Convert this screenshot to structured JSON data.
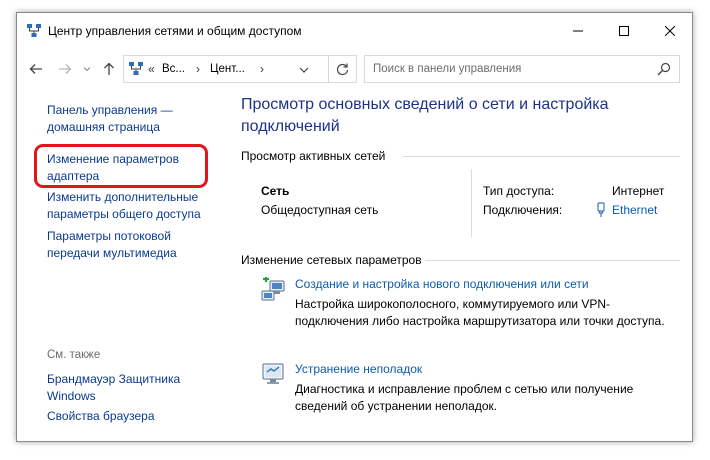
{
  "window": {
    "title": "Центр управления сетями и общим доступом"
  },
  "nav": {
    "address_crumbs": [
      "Вс...",
      "Цент..."
    ],
    "address_prefix": "«",
    "search_placeholder": "Поиск в панели управления"
  },
  "sidebar": {
    "home_link": "Панель управления — домашняя страница",
    "items": [
      {
        "label": "Изменение параметров адаптера",
        "highlighted": true
      },
      {
        "label": "Изменить дополнительные параметры общего доступа"
      },
      {
        "label": "Параметры потоковой передачи мультимедиа"
      }
    ],
    "see_also_label": "См. также",
    "see_also": [
      {
        "label": "Брандмауэр Защитника Windows"
      },
      {
        "label": "Свойства браузера"
      }
    ]
  },
  "main": {
    "title": "Просмотр основных сведений о сети и настройка подключений",
    "active_networks": {
      "header": "Просмотр активных сетей",
      "network_name": "Сеть",
      "network_type": "Общедоступная сеть",
      "access_type_label": "Тип доступа:",
      "access_type_value": "Интернет",
      "connections_label": "Подключения:",
      "connections_value": "Ethernet"
    },
    "change_settings": {
      "header": "Изменение сетевых параметров",
      "tasks": [
        {
          "title": "Создание и настройка нового подключения или сети",
          "description": "Настройка широкополосного, коммутируемого или VPN-подключения либо настройка маршрутизатора или точки доступа.",
          "icon": "new-connection-icon"
        },
        {
          "title": "Устранение неполадок",
          "description": "Диагностика и исправление проблем с сетью или получение сведений об устранении неполадок.",
          "icon": "troubleshoot-icon"
        }
      ]
    }
  },
  "colors": {
    "link": "#0b3a8c",
    "title_blue": "#1e3287",
    "highlight_red": "#e0161b"
  }
}
